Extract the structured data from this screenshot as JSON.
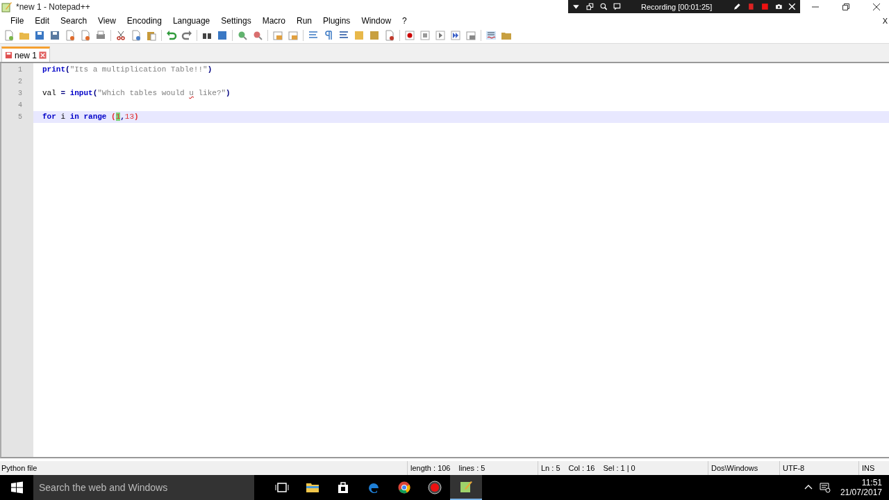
{
  "window": {
    "title": "*new 1 - Notepad++"
  },
  "recorder": {
    "status": "Recording [00:01:25]"
  },
  "menu": [
    "File",
    "Edit",
    "Search",
    "View",
    "Encoding",
    "Language",
    "Settings",
    "Macro",
    "Run",
    "Plugins",
    "Window",
    "?"
  ],
  "menu_close": "X",
  "tabs": [
    {
      "label": "new 1",
      "selected": true
    }
  ],
  "editor": {
    "lines": [
      {
        "number": "1",
        "current": false,
        "tokens": [
          {
            "text": "print",
            "kind": "keyword"
          },
          {
            "text": "(",
            "kind": "operator"
          },
          {
            "text": "\"Its a multiplication Table!!\"",
            "kind": "string"
          },
          {
            "text": ")",
            "kind": "operator"
          }
        ]
      },
      {
        "number": "2",
        "current": false
      },
      {
        "number": "3",
        "current": false,
        "tokens": [
          {
            "text": "val",
            "kind": "default"
          },
          {
            "text": " = ",
            "kind": "operator"
          },
          {
            "text": "input",
            "kind": "keyword"
          },
          {
            "text": "(",
            "kind": "operator"
          },
          {
            "text": "\"Which tables would ",
            "kind": "string"
          },
          {
            "text": "u",
            "kind": "misspelled"
          },
          {
            "text": " like?\"",
            "kind": "string"
          },
          {
            "text": ")",
            "kind": "operator"
          }
        ]
      },
      {
        "number": "4",
        "current": false
      },
      {
        "number": "5",
        "current": true,
        "tokens": [
          {
            "text": "for",
            "kind": "keyword"
          },
          {
            "text": " i ",
            "kind": "default"
          },
          {
            "text": "in",
            "kind": "keyword"
          },
          {
            "text": " range",
            "kind": "keyword"
          },
          {
            "text": " (",
            "kind": "brace"
          },
          {
            "text": "1",
            "kind": "matched"
          },
          {
            "text": ",",
            "kind": "operator"
          },
          {
            "text": "13",
            "kind": "number"
          },
          {
            "text": ")",
            "kind": "brace"
          }
        ]
      }
    ]
  },
  "status_bar": {
    "language": "Python file",
    "length": "length : 106",
    "lines": "lines : 5",
    "ln": "Ln : 5",
    "col": "Col : 16",
    "sel": "Sel : 1 | 0",
    "eol": "Dos\\Windows",
    "encoding": "UTF-8",
    "mode": "INS"
  },
  "taskbar": {
    "search": {
      "placeholder": "Search the web and Windows"
    },
    "time": "11:51",
    "date": "21/07/2017"
  }
}
